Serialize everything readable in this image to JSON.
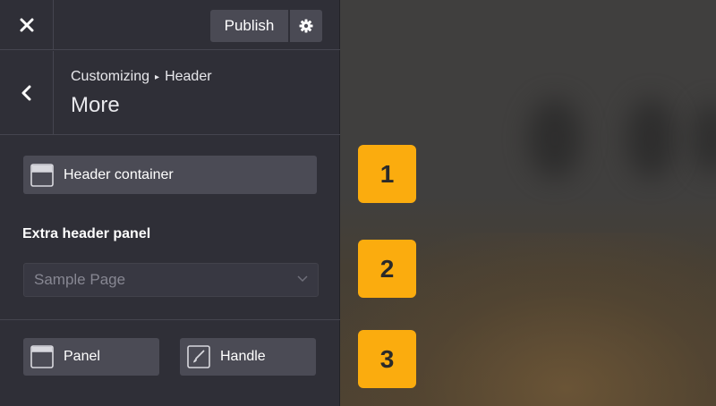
{
  "topbar": {
    "close_icon": "close-icon",
    "publish_label": "Publish",
    "settings_icon": "gear-icon"
  },
  "section": {
    "back_icon": "chevron-left-icon",
    "breadcrumb_root": "Customizing",
    "breadcrumb_separator": "▸",
    "breadcrumb_current": "Header",
    "title": "More"
  },
  "controls": {
    "header_container_label": "Header container",
    "header_container_icon": "header-layout-icon",
    "extra_panel_label": "Extra header panel",
    "extra_panel_select_value": "Sample Page",
    "panel_label": "Panel",
    "panel_icon": "panel-layout-icon",
    "handle_label": "Handle",
    "handle_icon": "brush-icon"
  },
  "badges": [
    "1",
    "2",
    "3"
  ],
  "colors": {
    "sidebar_bg": "#2f2f37",
    "button_bg": "#4b4b55",
    "badge": "#fbac0e"
  }
}
